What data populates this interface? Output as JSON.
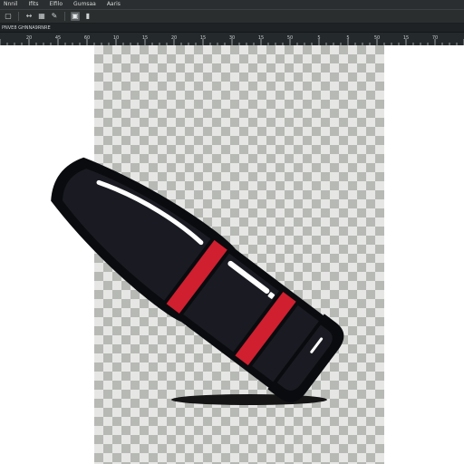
{
  "menu": {
    "items": [
      "Nnnil",
      "Ifits",
      "Elfilo",
      "Gumsaa",
      "Aaris"
    ]
  },
  "toolbar": {
    "tools": [
      {
        "icon": "checkbox-icon",
        "symbol": "▢",
        "boxed": false
      },
      {
        "icon": "move-icon",
        "symbol": "↔",
        "boxed": false
      },
      {
        "icon": "layers-icon",
        "symbol": "▦",
        "boxed": false
      },
      {
        "icon": "brush-icon",
        "symbol": "✎",
        "boxed": false
      },
      {
        "icon": "select-icon",
        "symbol": "▣",
        "boxed": true
      },
      {
        "icon": "gradient-icon",
        "symbol": "▮",
        "boxed": false
      }
    ]
  },
  "status": {
    "text": "PNVE8 GHNNA9RNRE"
  },
  "ruler": {
    "labels": [
      "20",
      "45",
      "60",
      "10",
      "15",
      "20",
      "15",
      "30",
      "15",
      "50",
      "5",
      "5",
      "50",
      "15",
      "70"
    ]
  },
  "canvas": {
    "checker_colors": {
      "light": "#e6e7e5",
      "dark": "#b7b9b5"
    },
    "artwork": "bullet"
  },
  "colors": {
    "outline": "#0a0b0e",
    "body": "#1a1b22",
    "stripe_red": "#d01f2f",
    "highlight": "#ffffff",
    "shadow": "#151515"
  }
}
